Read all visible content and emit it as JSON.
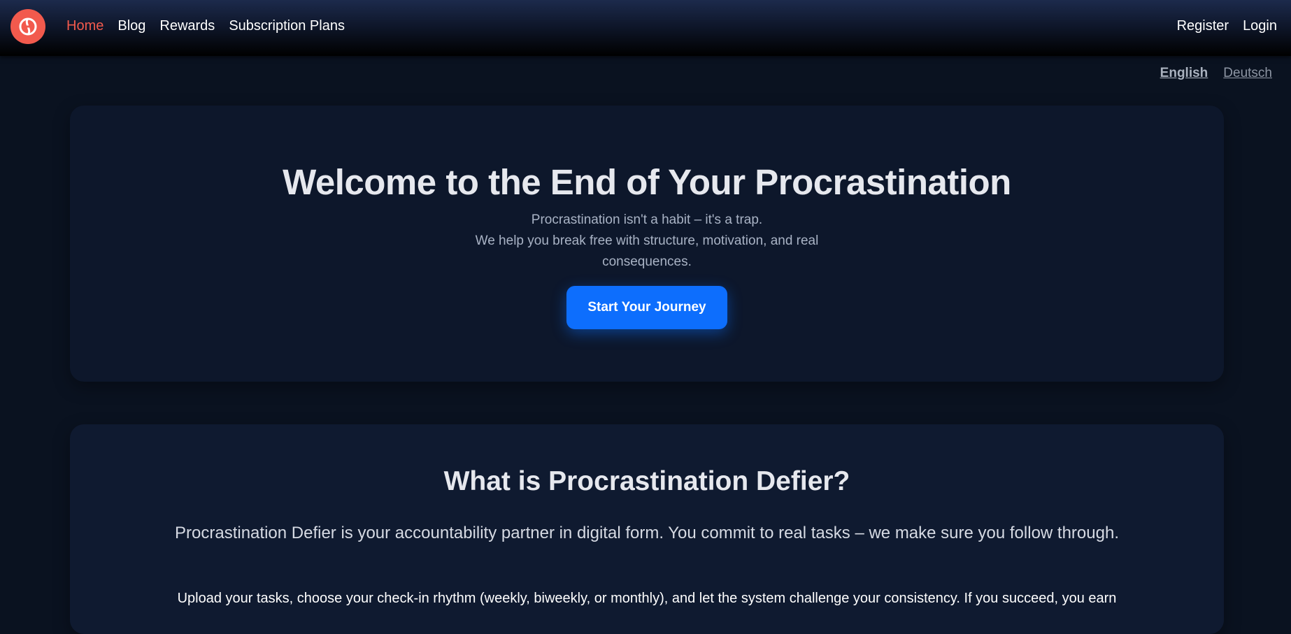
{
  "brand": {
    "logo_icon": "swirl-logo-icon",
    "accent": "#f25a4d"
  },
  "nav": {
    "left": [
      "Home",
      "Blog",
      "Rewards",
      "Subscription Plans"
    ],
    "right": [
      "Register",
      "Login"
    ],
    "active": "Home"
  },
  "languages": {
    "current": "English",
    "other": "Deutsch"
  },
  "hero": {
    "title": "Welcome to the End of Your Procrastination",
    "subtitle_line1": "Procrastination isn't a habit – it's a trap.",
    "subtitle_line2": "We help you break free with structure, motivation, and real consequences.",
    "cta_label": "Start Your Journey",
    "cta_color": "#0d6efd"
  },
  "about": {
    "title": "What is Procrastination Defier?",
    "paragraph1": "Procrastination Defier is your accountability partner in digital form. You commit to real tasks – we make sure you follow through.",
    "paragraph2": "Upload your tasks, choose your check-in rhythm (weekly, biweekly, or monthly), and let the system challenge your consistency. If you succeed, you earn"
  }
}
